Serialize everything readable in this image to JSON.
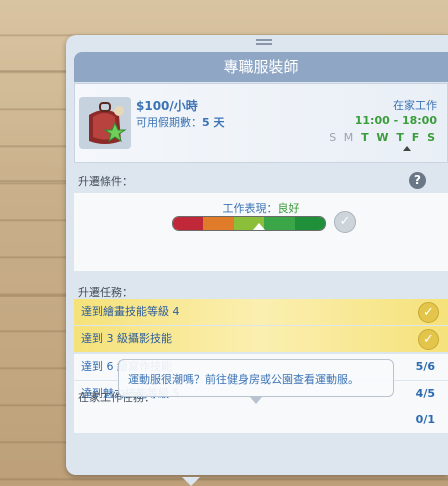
{
  "header": {
    "title": "專職服裝師"
  },
  "career": {
    "pay": "$100/小時",
    "vacation_label": "可用假期數：",
    "vacation_days": "5 天",
    "work_location": "在家工作",
    "hours": "11:00 - 18:00",
    "days_off": "S M",
    "days_work": "T W T F S"
  },
  "promotion": {
    "label": "升遷條件：",
    "help": "?",
    "performance_label": "工作表現：",
    "performance_value": "良好",
    "performance_level": 0.57
  },
  "tasks": {
    "label": "升遷任務：",
    "items": [
      {
        "text": "達到繪畫技能等級 4",
        "status": "done"
      },
      {
        "text": "達到 3 級攝影技能",
        "status": "done"
      },
      {
        "text": "達到 6 級寫作技能",
        "count": "5/6"
      },
      {
        "text": "達到魅力技能等級 5",
        "count": "4/5"
      }
    ]
  },
  "homework": {
    "label": "在家工作任務：",
    "count": "0/1"
  },
  "tooltip": {
    "text": "運動服很潮嗎？前往健身房或公園查看運動服。"
  },
  "colors": {
    "header": "#8fa7c5",
    "done_task": "#f5e27a",
    "text_blue": "#3c73b5",
    "good_green": "#3b9c3b"
  }
}
